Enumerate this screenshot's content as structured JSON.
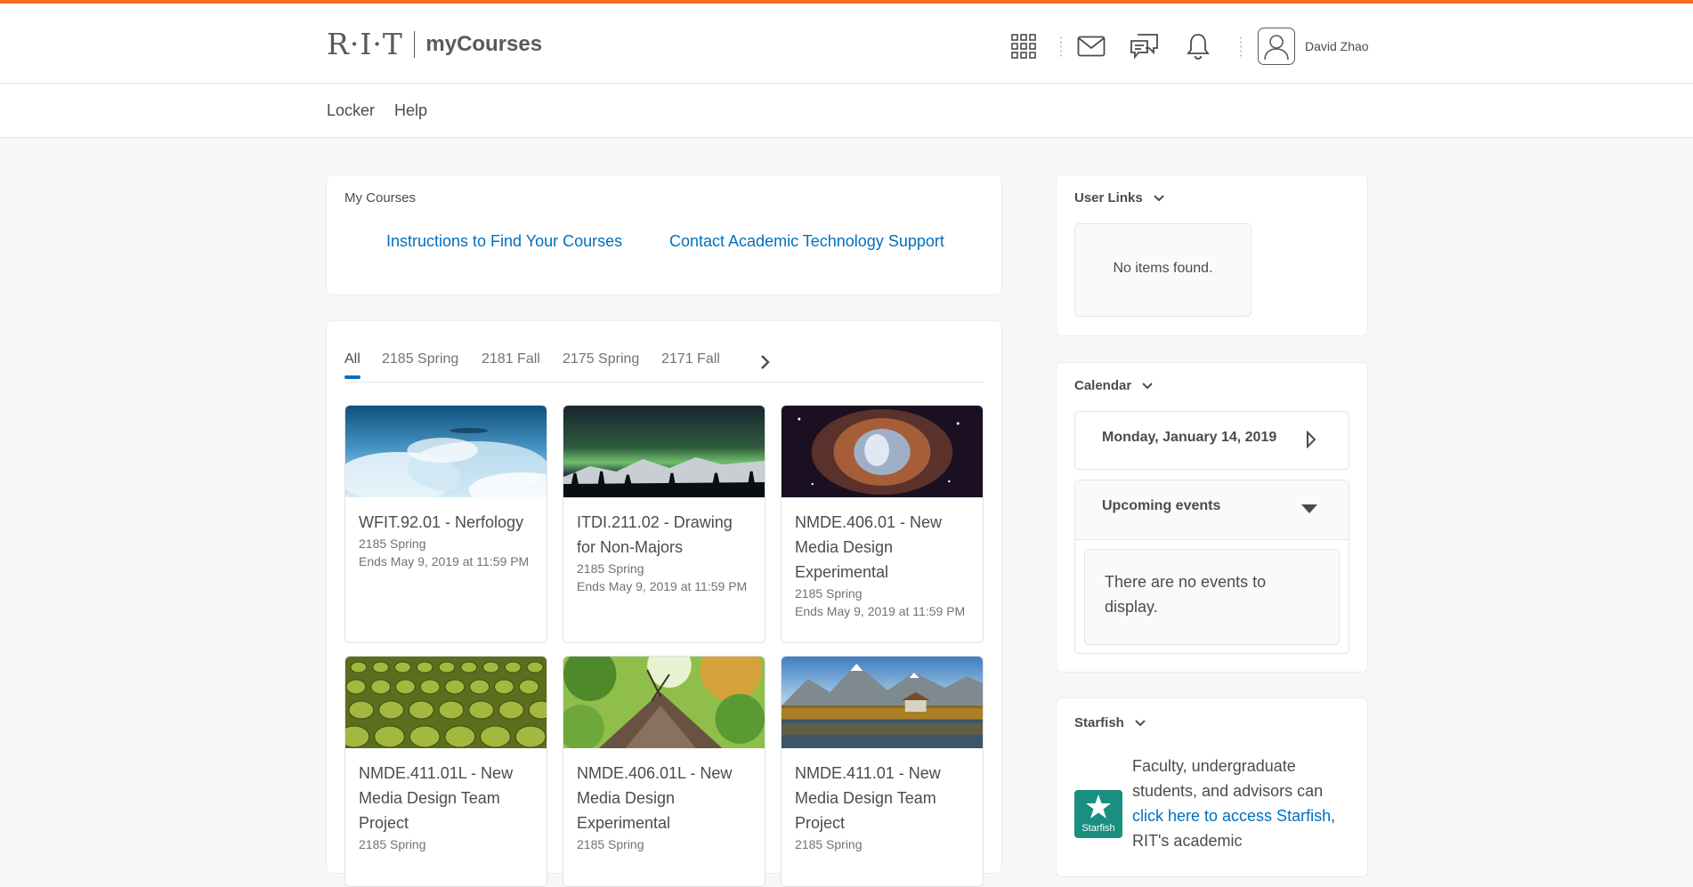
{
  "header": {
    "logo_rit": "R·I·T",
    "logo_product": "myCourses",
    "user_name": "David Zhao",
    "icons": [
      "waffle-grid-icon",
      "mail-icon",
      "chat-icon",
      "bell-icon",
      "user-avatar-icon"
    ]
  },
  "nav": {
    "items": [
      {
        "label": "Locker"
      },
      {
        "label": "Help"
      }
    ]
  },
  "my_courses": {
    "title": "My Courses",
    "links": [
      "Instructions to Find Your Courses",
      "Contact Academic Technology Support"
    ],
    "tabs": [
      {
        "label": "All"
      },
      {
        "label": "2185 Spring"
      },
      {
        "label": "2181 Fall"
      },
      {
        "label": "2175 Spring"
      },
      {
        "label": "2171 Fall"
      }
    ],
    "active_tab": "All",
    "courses": [
      {
        "title": "WFIT.92.01 - Nerfology",
        "term": "2185 Spring",
        "ends": "Ends May 9, 2019 at 11:59 PM",
        "image": "clouds-sky"
      },
      {
        "title": "ITDI.211.02 - Drawing for Non-Majors",
        "term": "2185 Spring",
        "ends": "Ends May 9, 2019 at 11:59 PM",
        "image": "aurora-mountains"
      },
      {
        "title": "NMDE.406.01 - New Media Design Experimental",
        "term": "2185 Spring",
        "ends": "Ends May 9, 2019 at 11:59 PM",
        "image": "nebula"
      },
      {
        "title": "NMDE.411.01L - New Media Design Team Project",
        "term": "2185 Spring",
        "ends": "",
        "image": "stadium-seats"
      },
      {
        "title": "NMDE.406.01L - New Media Design Experimental",
        "term": "2185 Spring",
        "ends": "",
        "image": "forest-canopy"
      },
      {
        "title": "NMDE.411.01 - New Media Design Team Project",
        "term": "2185 Spring",
        "ends": "",
        "image": "mountain-lake"
      }
    ]
  },
  "user_links": {
    "title": "User Links",
    "empty_text": "No items found."
  },
  "calendar": {
    "title": "Calendar",
    "date": "Monday, January 14, 2019",
    "upcoming_label": "Upcoming events",
    "empty_text": "There are no events to display."
  },
  "starfish": {
    "title": "Starfish",
    "logo_text": "Starfish",
    "text_before": "Faculty, undergraduate students, and advisors can ",
    "link_text": "click here to access Starfish",
    "text_after": ", RIT's academic"
  },
  "colors": {
    "accent": "#f36e21",
    "link": "#006fbf",
    "starfish": "#1a8f7f"
  }
}
